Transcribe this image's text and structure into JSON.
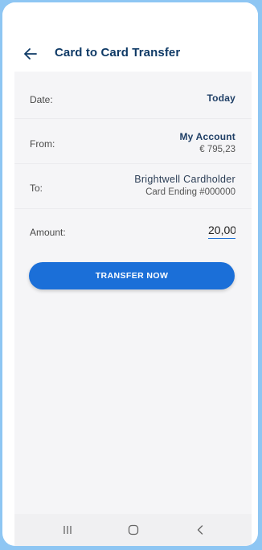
{
  "header": {
    "title": "Card to Card Transfer",
    "back_icon": "arrow-left-icon"
  },
  "form": {
    "date": {
      "label": "Date:",
      "value": "Today"
    },
    "from": {
      "label": "From:",
      "account": "My Account",
      "balance": "€ 795,23"
    },
    "to": {
      "label": "To:",
      "name": "Brightwell Cardholder",
      "card": "Card Ending #000000"
    },
    "amount": {
      "label": "Amount:",
      "value": "20,00"
    }
  },
  "actions": {
    "transfer_label": "TRANSFER NOW"
  },
  "navbar": {
    "recent_icon": "recent-apps-icon",
    "home_icon": "home-icon",
    "back_icon": "back-chevron-icon"
  },
  "colors": {
    "accent": "#1b6fd8",
    "title": "#0f3a66",
    "background": "#f5f5f7",
    "outer": "#8ec6f3"
  }
}
